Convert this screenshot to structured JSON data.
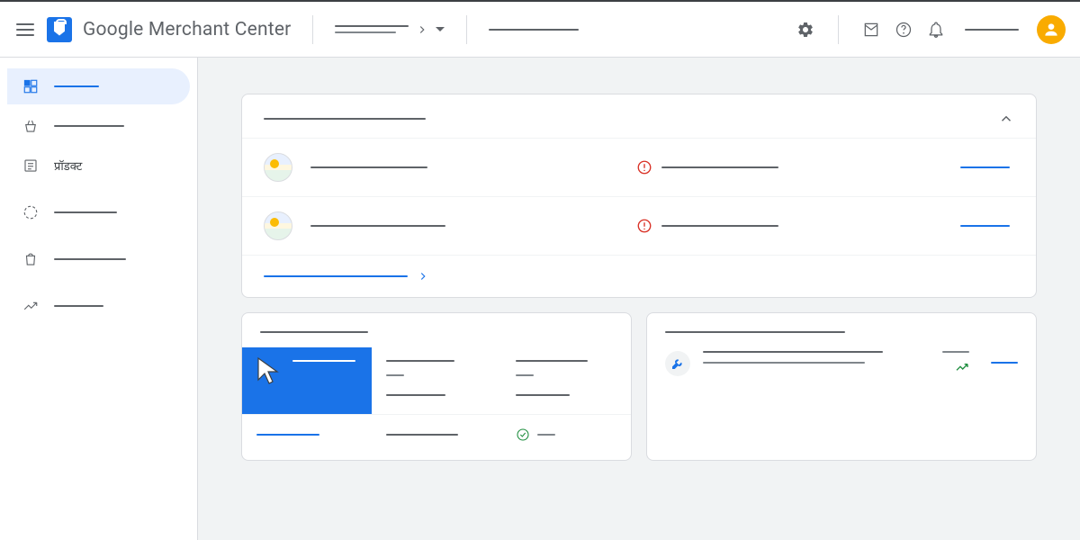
{
  "header": {
    "app_title": "Google Merchant Center",
    "dropdown_label": "",
    "secondary_label": ""
  },
  "sidebar": {
    "items": [
      {
        "icon": "overview",
        "label": ""
      },
      {
        "icon": "basket",
        "label": ""
      },
      {
        "icon": "products",
        "label": "प्रॉडक्ट"
      },
      {
        "icon": "performance",
        "label": ""
      },
      {
        "icon": "shopping",
        "label": ""
      },
      {
        "icon": "growth",
        "label": ""
      }
    ]
  },
  "main_card": {
    "title": "",
    "rows": [
      {
        "title": "",
        "status": "",
        "status_type": "error",
        "action": ""
      },
      {
        "title": "",
        "status": "",
        "status_type": "error",
        "action": ""
      }
    ],
    "footer_link": ""
  },
  "stats_card": {
    "title": "",
    "cells": [
      {
        "label": "",
        "value": "",
        "highlight": true
      },
      {
        "label": "",
        "value": ""
      },
      {
        "label": "",
        "value": ""
      }
    ],
    "row2": [
      {
        "value": "",
        "link": true
      },
      {
        "value": ""
      },
      {
        "value": "",
        "check": true
      }
    ]
  },
  "insight_card": {
    "title": "",
    "line1": "",
    "line2": "",
    "trend": "up",
    "action": ""
  }
}
